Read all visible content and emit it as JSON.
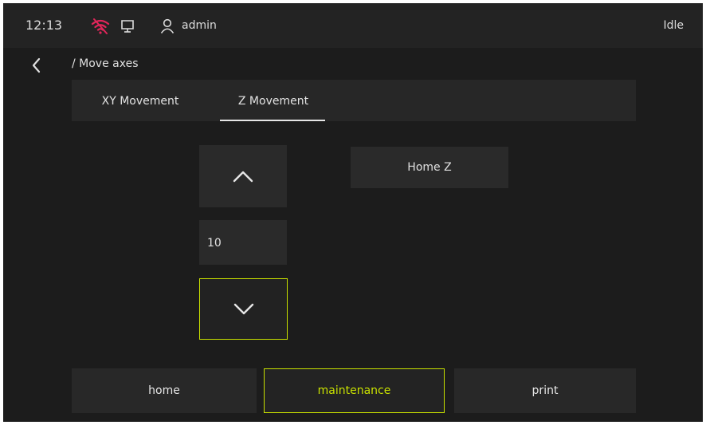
{
  "status_bar": {
    "time": "12:13",
    "wifi_icon": "wifi-off-icon",
    "wifi_color": "#e0265a",
    "display_icon": "display-icon",
    "user_icon": "user-icon",
    "username": "admin",
    "state": "Idle"
  },
  "breadcrumb": {
    "back_icon": "chevron-left-icon",
    "path": "/ Move axes"
  },
  "tabs": [
    {
      "label": "XY Movement",
      "active": false
    },
    {
      "label": "Z Movement",
      "active": true
    }
  ],
  "z_controls": {
    "up_icon": "chevron-up-icon",
    "step_value": "10",
    "down_icon": "chevron-down-icon",
    "home_label": "Home Z"
  },
  "nav": {
    "items": [
      {
        "label": "home",
        "active": false
      },
      {
        "label": "maintenance",
        "active": true
      },
      {
        "label": "print",
        "active": false
      }
    ],
    "accent_color": "#c8e000"
  }
}
